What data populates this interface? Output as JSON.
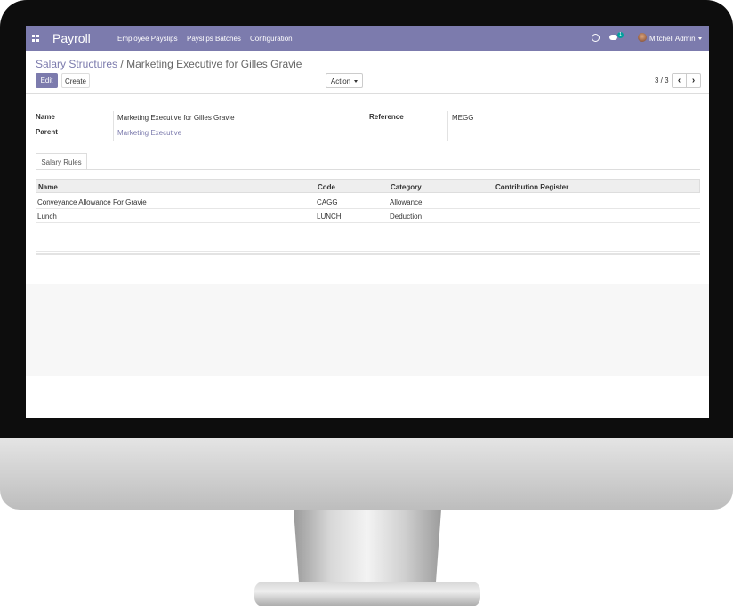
{
  "navbar": {
    "app_name": "Payroll",
    "menu": [
      "Employee Payslips",
      "Payslips Batches",
      "Configuration"
    ],
    "chat_badge": "1",
    "user": "Mitchell Admin",
    "color": "#7c7bad"
  },
  "breadcrumb": {
    "parent": "Salary Structures",
    "separator": "/",
    "current": "Marketing Executive for Gilles Gravie"
  },
  "buttons": {
    "edit": "Edit",
    "create": "Create",
    "action": "Action"
  },
  "pager": {
    "value": "3 / 3"
  },
  "form": {
    "name_label": "Name",
    "name_value": "Marketing Executive for Gilles Gravie",
    "parent_label": "Parent",
    "parent_value": "Marketing Executive",
    "reference_label": "Reference",
    "reference_value": "MEGG"
  },
  "tabs": [
    "Salary Rules"
  ],
  "table": {
    "headers": [
      "Name",
      "Code",
      "Category",
      "Contribution Register"
    ],
    "rows": [
      [
        "Conveyance Allowance For Gravie",
        "CAGG",
        "Allowance",
        ""
      ],
      [
        "Lunch",
        "LUNCH",
        "Deduction",
        ""
      ]
    ]
  },
  "icons": {
    "apps": "apps-grid-icon",
    "clock": "clock-icon",
    "chat": "chat-icon",
    "prev": "chevron-left-icon",
    "next": "chevron-right-icon"
  }
}
